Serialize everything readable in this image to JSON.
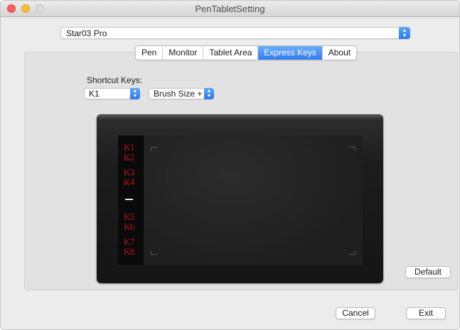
{
  "window": {
    "title": "PenTabletSetting",
    "accent_color": "#2f7cf0"
  },
  "device": {
    "selected": "Star03 Pro"
  },
  "tabs": [
    {
      "label": "Pen",
      "active": false
    },
    {
      "label": "Monitor",
      "active": false
    },
    {
      "label": "Tablet Area",
      "active": false
    },
    {
      "label": "Express Keys",
      "active": true
    },
    {
      "label": "About",
      "active": false
    }
  ],
  "shortcut": {
    "label": "Shortcut Keys:",
    "key_selected": "K1",
    "action_selected": "Brush Size +"
  },
  "tablet": {
    "keys": [
      "K1",
      "K2",
      "K3",
      "K4",
      "K5",
      "K6",
      "K7",
      "K8"
    ],
    "key_color": "#b8141b"
  },
  "buttons": {
    "default_label": "Default",
    "cancel_label": "Cancel",
    "exit_label": "Exit"
  }
}
